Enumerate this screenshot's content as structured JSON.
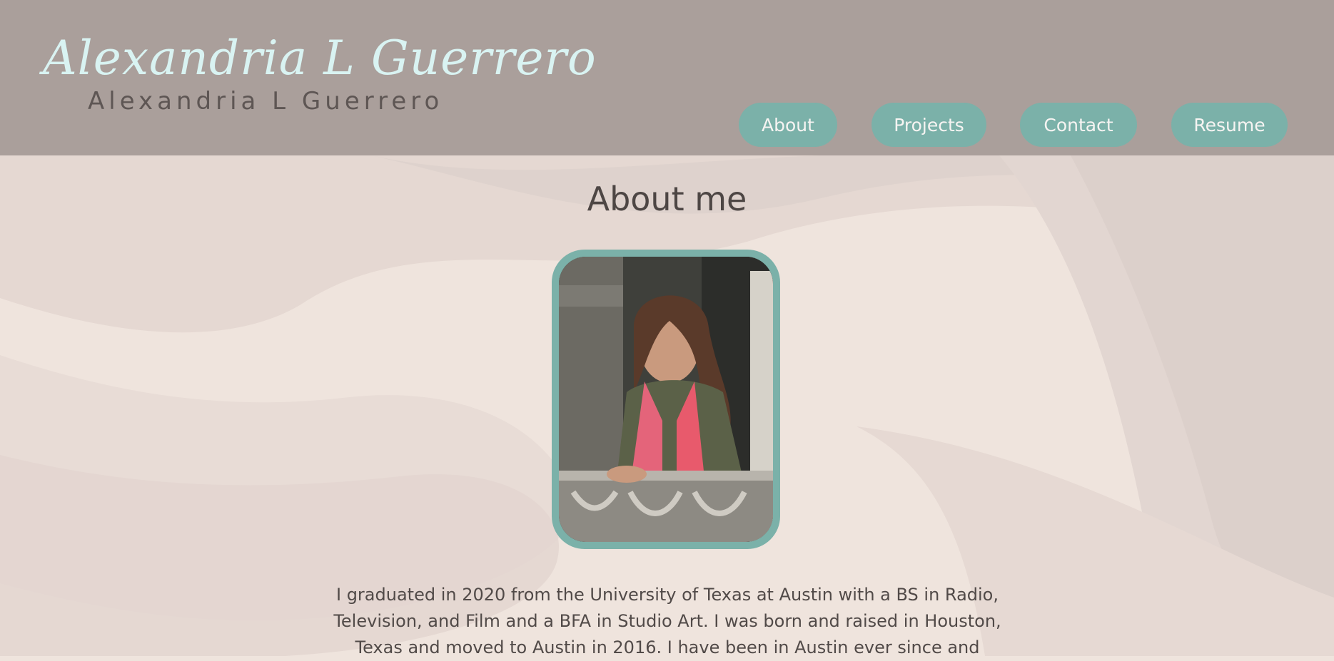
{
  "header": {
    "logo_script": "Alexandria L Guerrero",
    "logo_text": "Alexandria L Guerrero"
  },
  "nav": {
    "items": [
      {
        "label": "About"
      },
      {
        "label": "Projects"
      },
      {
        "label": "Contact"
      },
      {
        "label": "Resume"
      }
    ]
  },
  "main": {
    "title": "About me",
    "photo_icon": "profile-photo",
    "bio": "I graduated in 2020 from the University of Texas at Austin with a BS in Radio, Television, and Film and a BFA in Studio Art. I was born and raised in Houston, Texas and moved to Austin in 2016. I have been in Austin ever since and"
  },
  "colors": {
    "header_bg": "#aa9f9b",
    "accent": "#7bb1a9",
    "page_bg": "#efe4dd",
    "text": "#4d4644",
    "logo_script": "#d9f3f2"
  }
}
